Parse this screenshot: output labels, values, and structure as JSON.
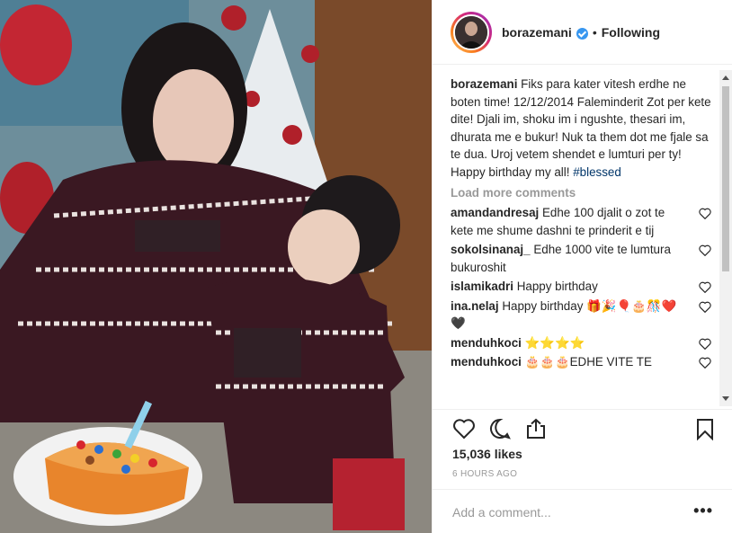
{
  "post": {
    "username": "borazemani",
    "separator": "•",
    "follow_status": "Following",
    "caption_user": "borazemani",
    "caption_text": "Fiks para kater vitesh erdhe ne boten time! 12/12/2014 Faleminderit Zot per kete dite! Djali im, shoku im i ngushte, thesari im, dhurata me e bukur! Nuk ta them dot me fjale sa te dua. Uroj vetem shendet e lumturi per ty! Happy birthday my all!",
    "caption_hashtag": "#blessed",
    "load_more": "Load more comments",
    "likes": "15,036 likes",
    "timestamp": "6 HOURS AGO",
    "add_comment_placeholder": "Add a comment...",
    "more_label": "•••"
  },
  "comments": [
    {
      "user": "amandandresaj",
      "text": "Edhe 100 djalit o zot te kete me shume dashni te prinderit e tij"
    },
    {
      "user": "sokolsinanaj_",
      "text": "Edhe 1000 vite te lumtura bukuroshit"
    },
    {
      "user": "islamikadri",
      "text": "Happy birthday"
    },
    {
      "user": "ina.nelaj",
      "text": "Happy birthday 🎁🎉🎈🎂🎊❤️🖤"
    },
    {
      "user": "menduhkoci",
      "text": "⭐⭐⭐⭐"
    },
    {
      "user": "menduhkoci",
      "text": "🎂🎂🎂EDHE VITE TE"
    }
  ],
  "icons": {
    "verified": "verified-badge-icon",
    "like": "heart-icon",
    "comment": "comment-bubble-icon",
    "share": "share-icon",
    "save": "bookmark-icon"
  },
  "colors": {
    "verified_blue": "#3897f0",
    "hashtag": "#003569",
    "muted": "#999999"
  }
}
